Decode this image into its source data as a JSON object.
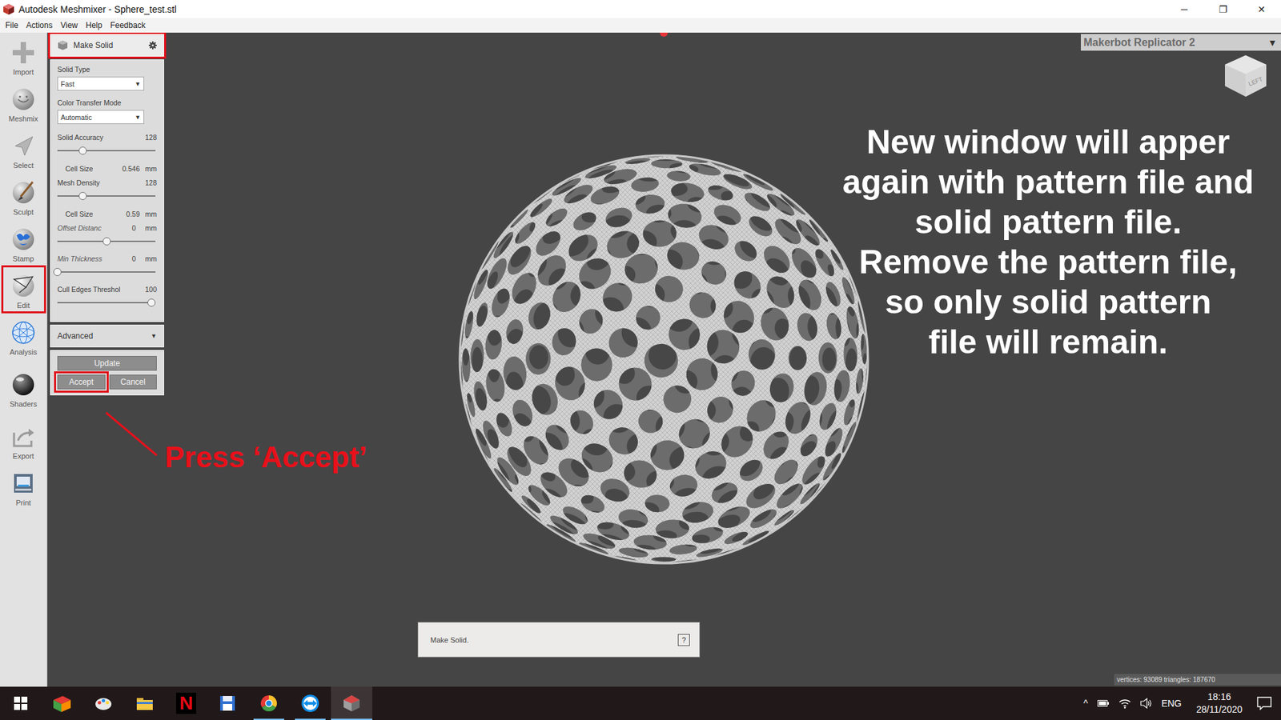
{
  "window": {
    "title": "Autodesk Meshmixer - Sphere_test.stl",
    "controls": [
      "─",
      "❐",
      "✕"
    ]
  },
  "menu": [
    "File",
    "Actions",
    "View",
    "Help",
    "Feedback"
  ],
  "tools": [
    {
      "label": "Import",
      "highlighted": false
    },
    {
      "label": "Meshmix",
      "highlighted": false
    },
    {
      "label": "Select",
      "highlighted": false
    },
    {
      "label": "Sculpt",
      "highlighted": false
    },
    {
      "label": "Stamp",
      "highlighted": false
    },
    {
      "label": "Edit",
      "highlighted": true
    },
    {
      "label": "Analysis",
      "highlighted": false
    },
    {
      "label": "Shaders",
      "highlighted": false
    },
    {
      "label": "Export",
      "highlighted": false
    },
    {
      "label": "Print",
      "highlighted": false
    }
  ],
  "panel": {
    "title": "Make Solid",
    "highlighted": true,
    "fields": [
      {
        "kind": "dropdown",
        "label": "Solid Type",
        "value": "Fast",
        "arrow": "▼"
      },
      {
        "kind": "dropdown",
        "label": "Color Transfer Mode",
        "value": "Automatic",
        "arrow": "▼"
      },
      {
        "kind": "slider",
        "label": "Solid Accuracy",
        "value": "128",
        "unit": "",
        "level": 0.26,
        "italic": false
      },
      {
        "kind": "readout",
        "label": "Cell Size",
        "value": "0.546",
        "unit": "mm"
      },
      {
        "kind": "slider",
        "label": "Mesh Density",
        "value": "128",
        "unit": "",
        "level": 0.26,
        "italic": false
      },
      {
        "kind": "readout",
        "label": "Cell Size",
        "value": "0.59",
        "unit": "mm"
      },
      {
        "kind": "slider",
        "label": "Offset Distanc",
        "value": "0",
        "unit": "mm",
        "level": 0.5,
        "italic": true
      },
      {
        "kind": "slider",
        "label": "Min Thickness",
        "value": "0",
        "unit": "mm",
        "level": 0.0,
        "italic": true
      },
      {
        "kind": "slider",
        "label": "Cull Edges Threshol",
        "value": "100",
        "unit": "",
        "level": 0.96,
        "italic": false
      }
    ],
    "advanced": {
      "label": "Advanced",
      "arrow": "▼"
    },
    "buttons": [
      {
        "label": "Update",
        "highlighted": false
      },
      {
        "label": "Accept",
        "highlighted": true
      },
      {
        "label": "Cancel",
        "highlighted": false
      }
    ]
  },
  "printer": {
    "label": "Makerbot Replicator 2",
    "arrow": "▼"
  },
  "view_cube": "LEFT",
  "annotations": {
    "instruction": [
      "New window will apper",
      "again with pattern file and",
      "solid pattern file.",
      "Remove the pattern file,",
      "so only solid pattern",
      "file will remain."
    ],
    "callout": "Press ‘Accept’"
  },
  "status": {
    "text": "Make Solid.",
    "help": "?"
  },
  "stats": "vertices: 93089 triangles: 187670",
  "taskbar": {
    "apps": [
      {
        "running": false,
        "selected": false
      },
      {
        "running": false,
        "selected": false
      },
      {
        "running": false,
        "selected": false
      },
      {
        "running": false,
        "selected": false,
        "glyph": "N"
      },
      {
        "running": false,
        "selected": false
      },
      {
        "running": true,
        "selected": false
      },
      {
        "running": true,
        "selected": false
      },
      {
        "running": true,
        "selected": true
      }
    ],
    "tray_arrow": "^",
    "language": "ENG",
    "time": "18:16",
    "date": "28/11/2020"
  }
}
